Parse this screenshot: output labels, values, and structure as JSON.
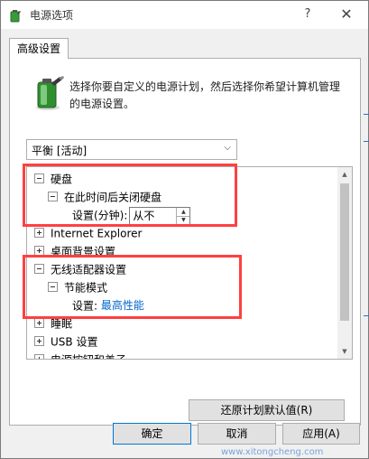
{
  "window": {
    "title": "电源选项",
    "help_glyph": "?",
    "close_glyph": "✕"
  },
  "tab": {
    "label": "高级设置"
  },
  "description": "选择你要自定义的电源计划，然后选择你希望计算机管理的电源设置。",
  "plan_select": {
    "value": "平衡 [活动]",
    "arrow": "⌵"
  },
  "tree": {
    "rows": [
      {
        "label": "硬盘",
        "toggle": "minus",
        "indent": 0
      },
      {
        "label": "在此时间后关闭硬盘",
        "toggle": "minus",
        "indent": 1
      },
      {
        "label": "设置(分钟):",
        "value": "从不",
        "indent": 2,
        "type": "spinner"
      },
      {
        "label": "Internet Explorer",
        "toggle": "plus",
        "indent": 0
      },
      {
        "label": "桌面背景设置",
        "toggle": "plus",
        "indent": 0
      },
      {
        "label": "无线适配器设置",
        "toggle": "minus",
        "indent": 0
      },
      {
        "label": "节能模式",
        "toggle": "minus",
        "indent": 1
      },
      {
        "label": "设置:",
        "value": "最高性能",
        "indent": 2,
        "type": "link"
      },
      {
        "label": "睡眠",
        "toggle": "plus",
        "indent": 0
      },
      {
        "label": "USB 设置",
        "toggle": "plus",
        "indent": 0
      },
      {
        "label": "电源按钮和盖子",
        "toggle": "plus",
        "indent": 0
      }
    ]
  },
  "restore_button": "还原计划默认值(R)",
  "buttons": {
    "ok": "确定",
    "cancel": "取消",
    "apply": "应用(A)"
  },
  "watermark": "www.xitongcheng.com",
  "colors": {
    "highlight": "#ff4040",
    "link": "#0066cc",
    "accent": "#0078d7"
  }
}
